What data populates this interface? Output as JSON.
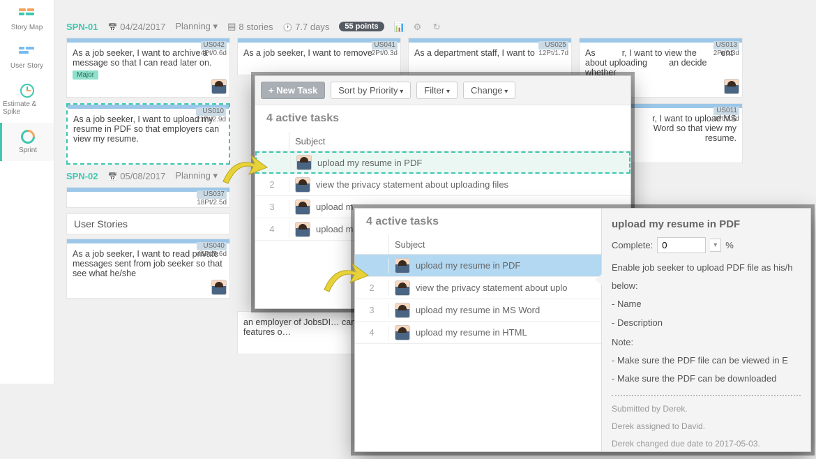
{
  "sidebar": {
    "items": [
      {
        "label": "Story Map"
      },
      {
        "label": "User Story"
      },
      {
        "label": "Estimate & Spike"
      },
      {
        "label": "Sprint"
      }
    ]
  },
  "sprint1": {
    "id": "SPN-01",
    "date": "04/24/2017",
    "status": "Planning",
    "storiesLabel": "8 stories",
    "daysLabel": "7.7 days",
    "pointsLabel": "55 points"
  },
  "sprint2": {
    "id": "SPN-02",
    "date": "05/08/2017",
    "status": "Planning"
  },
  "sectionTitle": "User Stories",
  "cards": {
    "c1": {
      "uid": "US042",
      "pts": "4Pt/0.6d",
      "text": "As a job seeker, I want to archive a message so that I can read later on.",
      "tag": "Major"
    },
    "c2": {
      "uid": "US010",
      "pts": "21Pt/2.9d",
      "text": "As a job seeker, I want to upload my resume in PDF so that employers can view my resume."
    },
    "c3": {
      "uid": "US041",
      "pts": "2Pt/0.3d",
      "text": "As a job seeker, I want to remove"
    },
    "c4": {
      "uid": "US025",
      "pts": "12Pt/1.7d",
      "text": "As a department staff, I want to"
    },
    "c5": {
      "uid": "US013",
      "pts": "2Pt/0.3d",
      "text": "As           r, I want to view the          ent about uploading         an decide whether"
    },
    "c6": {
      "uid": "US011",
      "pts": "3Pt/0.4d",
      "text": "r, I want to upload MS Word so that view my resume."
    },
    "c7": {
      "uid": "US037",
      "pts": "18Pt/2.5d",
      "text": ""
    },
    "c8": {
      "uid": "US040",
      "pts": "40Pt/5.6d",
      "text": "As a job seeker, I want to read private messages sent from job seeker so that see what he/she"
    },
    "c9": {
      "text": "an employer of JobsDI… can enjoy the features o…"
    }
  },
  "toolbar": {
    "newTask": "+ New Task",
    "sort": "Sort by Priority",
    "filter": "Filter",
    "change": "Change"
  },
  "tasksTitle": "4 active tasks",
  "subjectLabel": "Subject",
  "tasks": {
    "t1": "upload my resume in PDF",
    "t2": "view the privacy statement about uploading files",
    "t3": "upload m",
    "t4": "upload m"
  },
  "tasks2": {
    "t1": "upload my resume in PDF",
    "t2": "view the privacy statement about uplo",
    "t3": "upload my resume in MS Word",
    "t4": "upload my resume in HTML"
  },
  "detail": {
    "title": "upload my resume in PDF",
    "completeLabel": "Complete:",
    "completeValue": "0",
    "pct": "%",
    "desc1": "Enable job seeker to upload PDF file as his/h",
    "desc2": "below:",
    "desc3": "- Name",
    "desc4": "- Description",
    "note": "Note:",
    "n1": "- Make sure the PDF file can be viewed in E",
    "n2": "- Make sure the PDF can be downloaded",
    "log1": "Submitted by Derek.",
    "log2": "Derek assigned to David.",
    "log3": "Derek changed due date to 2017-05-03."
  }
}
